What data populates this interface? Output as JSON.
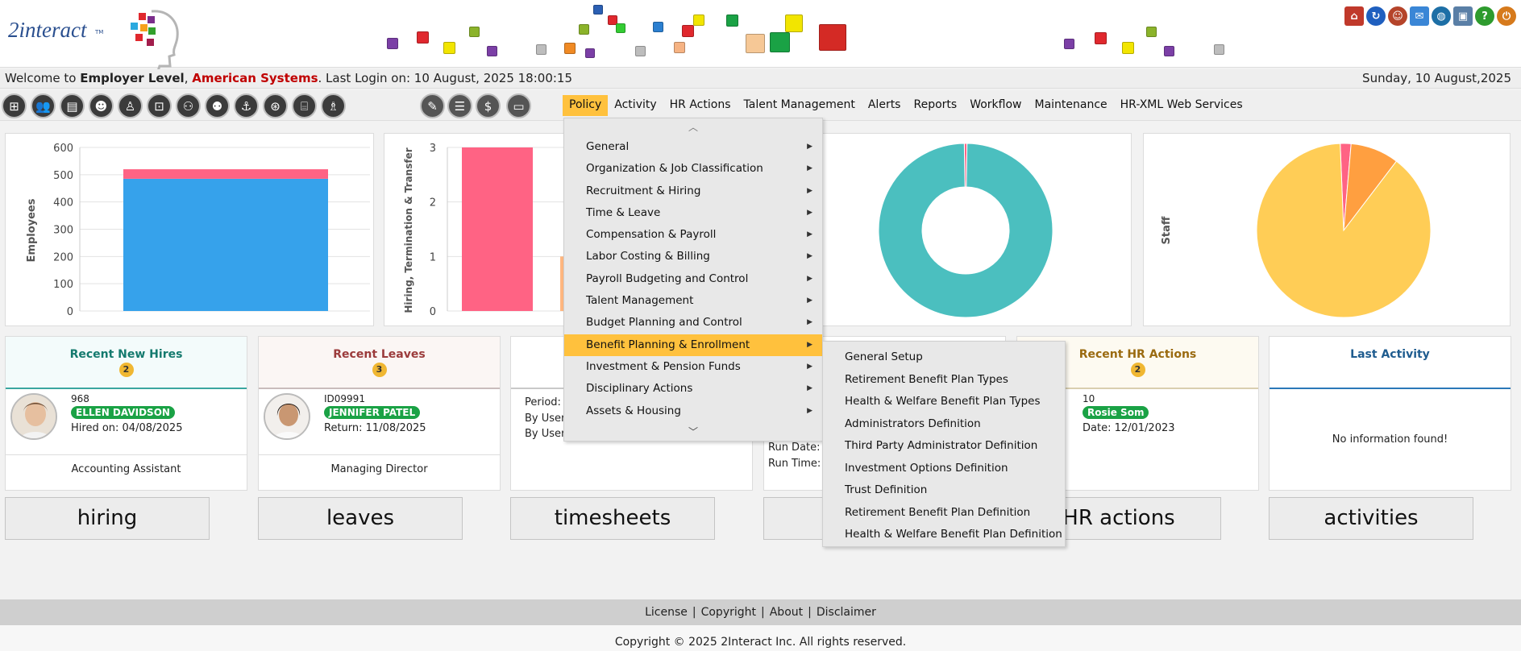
{
  "brand": {
    "logo_text": "2interact",
    "logo_suffix": "TM"
  },
  "welcome": {
    "prefix": "Welcome to ",
    "level": "Employer Level",
    "sep": ", ",
    "company": "American Systems",
    "login_text": ". Last Login on: 10 August, 2025 18:00:15",
    "date": "Sunday, 10 August,2025"
  },
  "menu": [
    "Policy",
    "Activity",
    "HR Actions",
    "Talent Management",
    "Alerts",
    "Reports",
    "Workflow",
    "Maintenance",
    "HR-XML Web Services"
  ],
  "dropdown": {
    "items": [
      "General",
      "Organization & Job Classification",
      "Recruitment & Hiring",
      "Time & Leave",
      "Compensation & Payroll",
      "Labor Costing & Billing",
      "Payroll Budgeting and Control",
      "Talent Management",
      "Budget Planning and Control",
      "Benefit Planning & Enrollment",
      "Investment & Pension Funds",
      "Disciplinary Actions",
      "Assets & Housing"
    ],
    "active_index": 9
  },
  "submenu": [
    "General Setup",
    "Retirement Benefit Plan Types",
    "Health & Welfare Benefit Plan Types",
    "Administrators Definition",
    "Third Party Administrator Definition",
    "Investment Options Definition",
    "Trust Definition",
    "Retirement Benefit Plan Definition",
    "Health & Welfare Benefit Plan Definition"
  ],
  "charts": {
    "employees": {
      "ylabel": "Employees",
      "ticks": [
        "600",
        "500",
        "400",
        "300",
        "200",
        "100",
        "0"
      ]
    },
    "hiring": {
      "ylabel": "Hiring, Termination & Transfer",
      "ticks": [
        "3",
        "2",
        "1",
        "0"
      ]
    },
    "staff": {
      "ylabel": "Staff"
    }
  },
  "chart_data": [
    {
      "type": "bar",
      "ylabel": "Employees",
      "ylim": [
        0,
        600
      ],
      "categories": [
        ""
      ],
      "series": [
        {
          "values": [
            485
          ]
        },
        {
          "values": [
            35
          ]
        }
      ]
    },
    {
      "type": "bar",
      "ylabel": "Hiring, Termination & Transfer",
      "ylim": [
        0,
        3
      ],
      "categories": [
        ""
      ],
      "series": [
        {
          "values": [
            3
          ]
        },
        {
          "values": [
            1
          ]
        }
      ]
    },
    {
      "type": "pie",
      "values": [
        99.5,
        0.5
      ]
    },
    {
      "type": "pie",
      "ylabel": "Staff",
      "values": [
        89,
        9,
        2
      ]
    }
  ],
  "cards": {
    "hires": {
      "title": "Recent New Hires",
      "count": "2",
      "id": "968",
      "name": "ELLEN DAVIDSON",
      "date": "Hired on: 04/08/2025",
      "role": "Accounting Assistant"
    },
    "leaves": {
      "title": "Recent Leaves",
      "count": "3",
      "id": "ID09991",
      "name": "JENNIFER PATEL",
      "date": "Return: 11/08/2025",
      "role": "Managing Director"
    },
    "timesheets": {
      "line1": "Period:",
      "line2": "By User:",
      "line3": "By User"
    },
    "payroll": {
      "line1": "Run Date:",
      "line2": "Run Time:"
    },
    "hr_actions": {
      "title": "Recent HR Actions",
      "count": "2",
      "id": "10",
      "name": "Rosie Som",
      "date": "Date: 12/01/2023"
    },
    "activity": {
      "title": "Last Activity",
      "empty": "No information found!"
    }
  },
  "buttons": [
    "hiring",
    "leaves",
    "timesheets",
    "HR actions",
    "activities"
  ],
  "footer": {
    "links": [
      "License",
      "Copyright",
      "About",
      "Disclaimer"
    ],
    "sep": "|",
    "copyright": "Copyright © 2025 2Interact Inc. All rights reserved."
  },
  "colors": {
    "accent": "#ffc13d",
    "teal": "#4bbfbf",
    "pink": "#ff6384",
    "blue": "#36a2eb",
    "yellow": "#ffcd56",
    "orange": "#ff9f40",
    "green": "#1aa245"
  }
}
